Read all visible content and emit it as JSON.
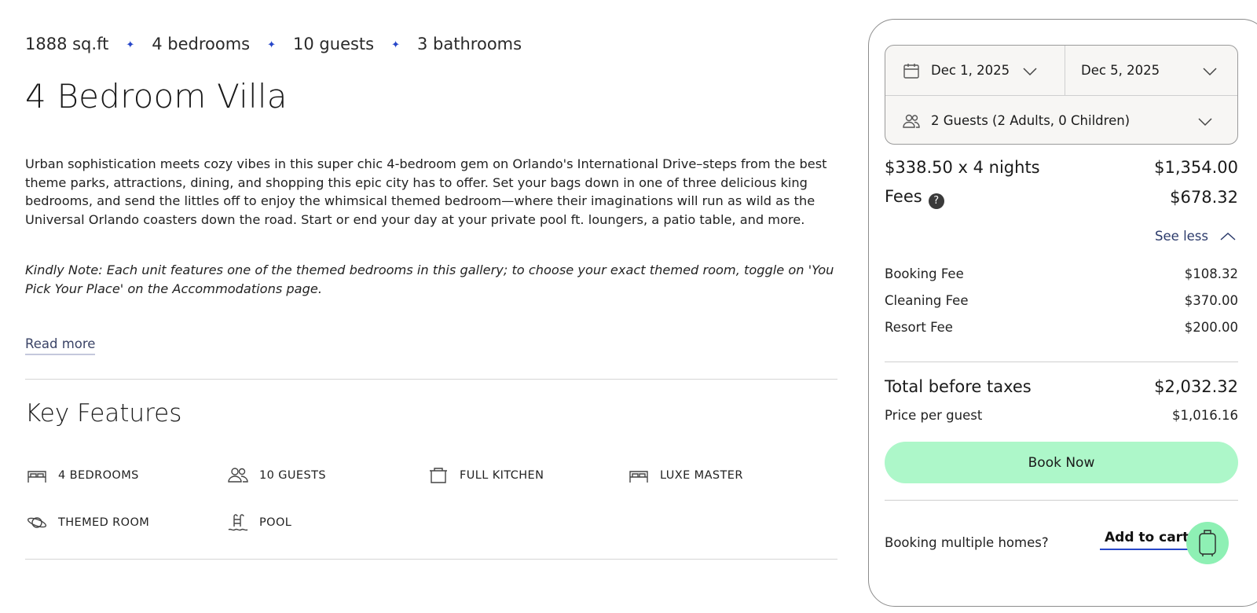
{
  "listing": {
    "stats": [
      "1888 sq.ft",
      "4 bedrooms",
      "10 guests",
      "3 bathrooms"
    ],
    "separator": "✦",
    "title": "4 Bedroom Villa",
    "description": "Urban sophistication meets cozy vibes in this super chic 4-bedroom gem on Orlando's International Drive–steps from the best theme parks, attractions, dining, and shopping this epic city has to offer. Set your bags down in one of three delicious king bedrooms, and send the littles off to enjoy the whimsical themed bedroom—where their imaginations will run as wild as the Universal Orlando coasters down the road. Start or end your day at your private pool ft. loungers, a patio table, and more.",
    "note": "Kindly Note: Each unit features one of the themed bedrooms in this gallery; to choose your exact themed room, toggle on 'You Pick Your Place' on the Accommodations page.",
    "read_more": "Read more",
    "key_features_title": "Key Features",
    "features": [
      {
        "label": "4 BEDROOMS",
        "icon": "bed-icon"
      },
      {
        "label": "10 GUESTS",
        "icon": "people-icon"
      },
      {
        "label": "FULL KITCHEN",
        "icon": "pot-icon"
      },
      {
        "label": "LUXE MASTER",
        "icon": "bed-icon"
      },
      {
        "label": "THEMED ROOM",
        "icon": "planet-icon"
      },
      {
        "label": "POOL",
        "icon": "pool-ladder-icon"
      }
    ]
  },
  "booking": {
    "check_in": "Dec 1, 2025",
    "check_out": "Dec 5, 2025",
    "guests": "2 Guests (2 Adults, 0 Children)",
    "nights_label": "$338.50 x 4 nights",
    "nights_total": "$1,354.00",
    "fees_label": "Fees",
    "fees_help": "?",
    "fees_total": "$678.32",
    "see_less": "See less",
    "fee_items": [
      {
        "label": "Booking Fee",
        "amount": "$108.32"
      },
      {
        "label": "Cleaning Fee",
        "amount": "$370.00"
      },
      {
        "label": "Resort Fee",
        "amount": "$200.00"
      }
    ],
    "total_label": "Total before taxes",
    "total_amount": "$2,032.32",
    "per_guest_label": "Price per guest",
    "per_guest_amount": "$1,016.16",
    "book_now": "Book Now",
    "multiple_homes": "Booking multiple homes?",
    "add_to_cart": "Add to cart"
  },
  "colors": {
    "accent_blue": "#2747c9",
    "book_button": "#adf7c9",
    "cart_button": "#8ef0b4",
    "link": "#2b3a6b"
  }
}
